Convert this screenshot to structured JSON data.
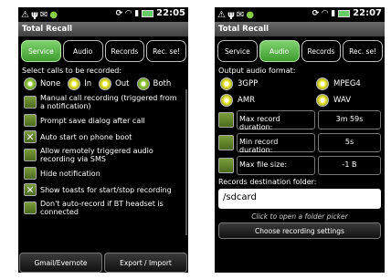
{
  "left": {
    "time": "22:05",
    "title": "Total Recall",
    "tabs": [
      "Service",
      "Audio",
      "Records",
      "Rec. se!"
    ],
    "select_label": "Select calls to be recorded:",
    "radios": [
      "None",
      "In",
      "Out",
      "Both"
    ],
    "options": [
      {
        "text": "Manual call recording (triggered from a notification)",
        "checked": false
      },
      {
        "text": "Prompt save dialog after call",
        "checked": false
      },
      {
        "text": "Auto start on phone boot",
        "checked": true
      },
      {
        "text": "Allow remotely triggered audio recording via SMS",
        "checked": false
      },
      {
        "text": "Hide notification",
        "checked": false
      },
      {
        "text": "Show toasts for start/stop recording",
        "checked": true
      },
      {
        "text": "Don't auto-record if BT headset is connected",
        "checked": false
      }
    ],
    "buttons": [
      "Gmail/Evernote",
      "Export / Import"
    ]
  },
  "right": {
    "time": "22:07",
    "title": "Total Recall",
    "tabs": [
      "Service",
      "Audio",
      "Records",
      "Rec. se!"
    ],
    "format_label": "Output audio format:",
    "formats": [
      "3GPP",
      "MPEG4",
      "AMR",
      "WAV"
    ],
    "inputs": [
      {
        "label": "Max record duration:",
        "value": "3m 59s"
      },
      {
        "label": "Min record duration:",
        "value": "5s"
      },
      {
        "label": "Max file size:",
        "value": "-1 B"
      }
    ],
    "folder_label": "Records destination folder:",
    "folder_value": "/sdcard",
    "folder_hint": "Click to open a folder picker",
    "choose_button": "Choose recording settings"
  }
}
